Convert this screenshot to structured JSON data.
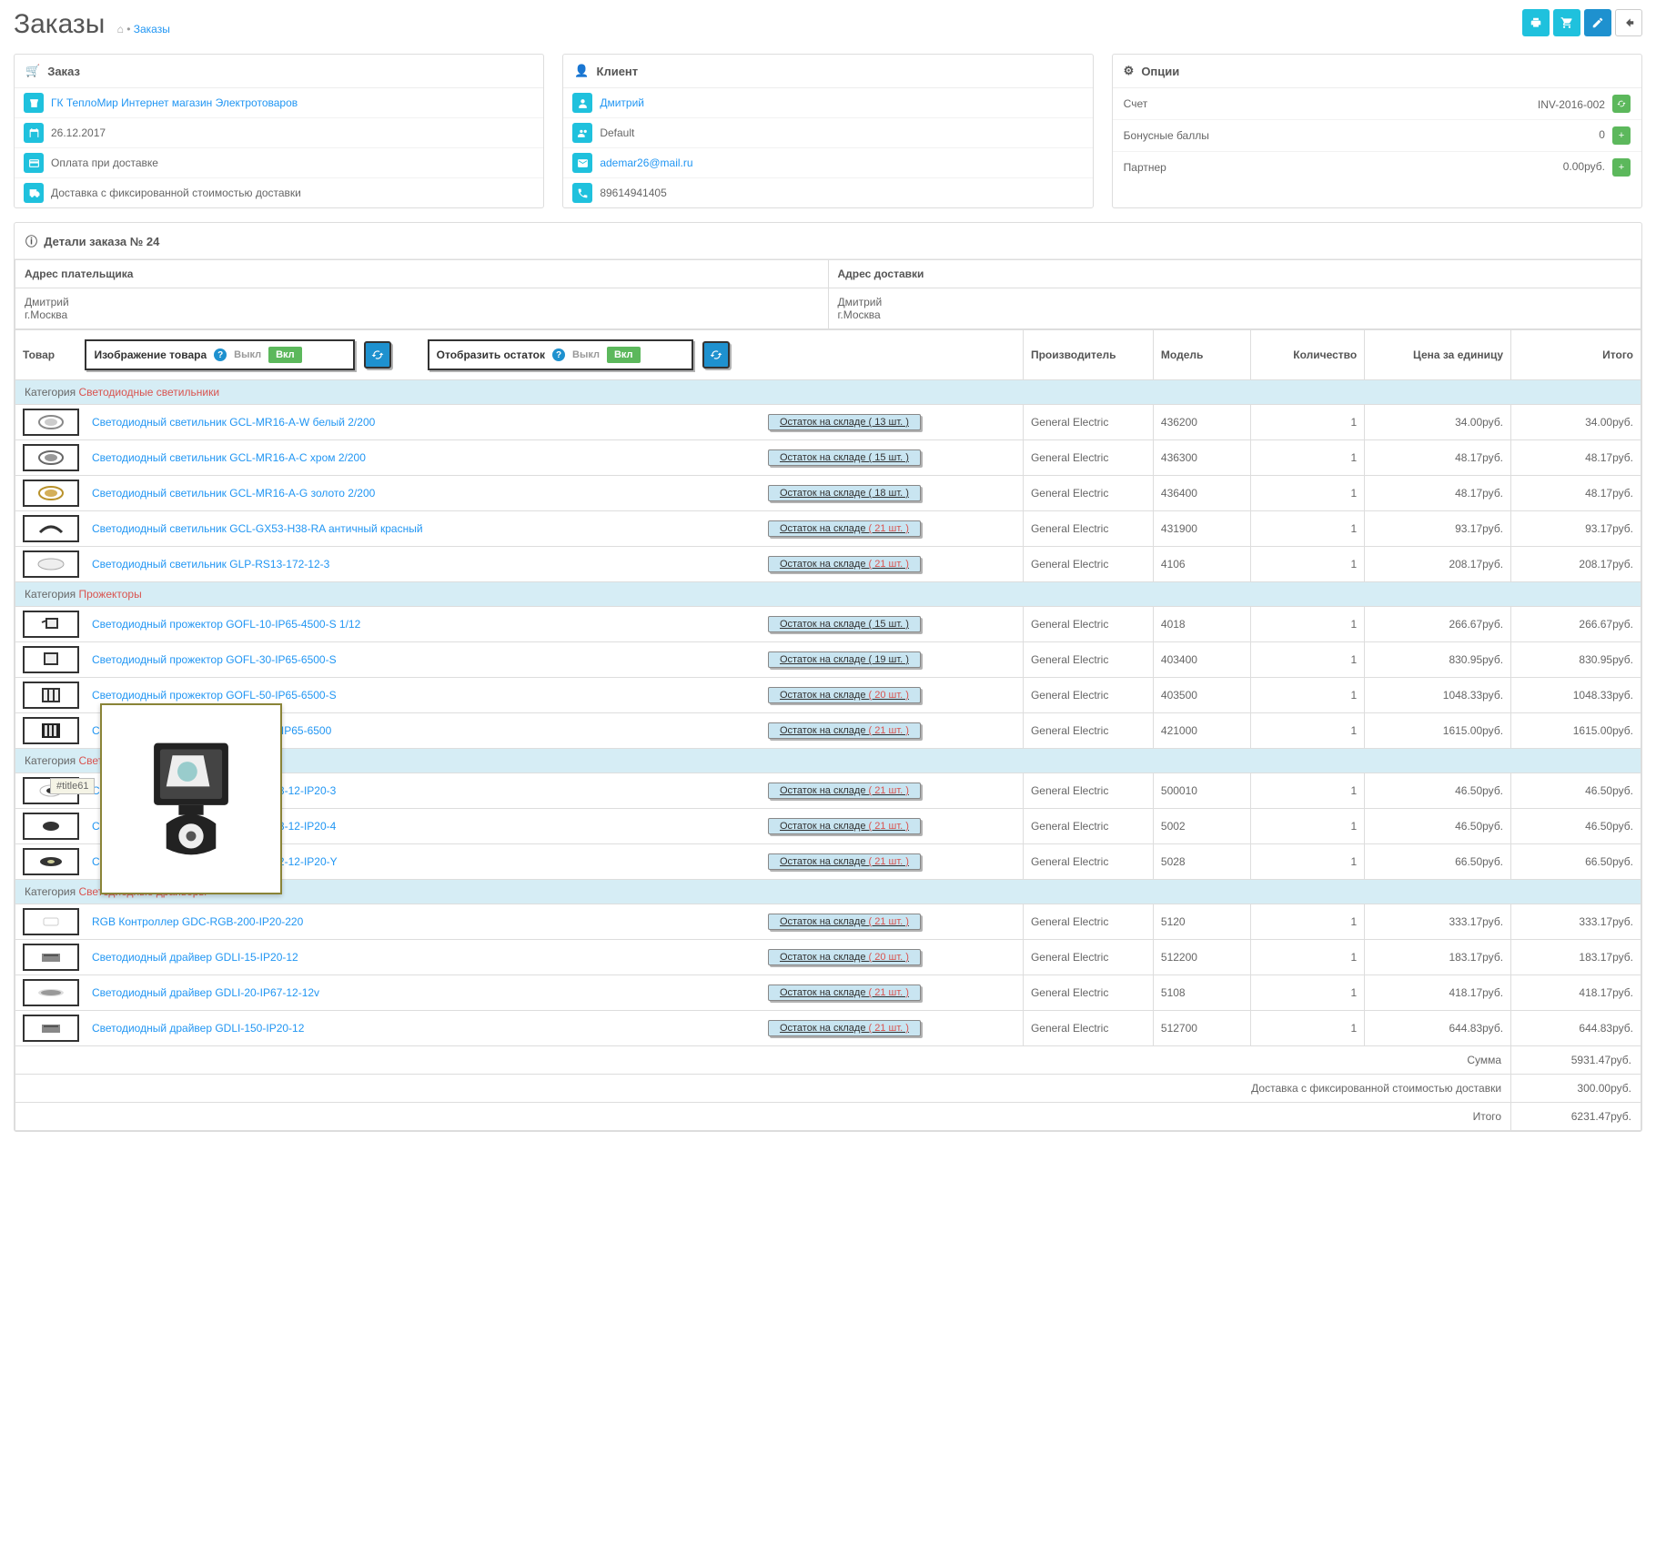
{
  "page": {
    "title": "Заказы",
    "bc_home": "⌂",
    "bc_page": "Заказы"
  },
  "toolbar": {
    "print": "print",
    "cart": "cart",
    "edit": "edit",
    "back": "back"
  },
  "order_panel": {
    "title": "Заказ",
    "store": "ГК ТеплоМир Интернет магазин Электротоваров",
    "date": "26.12.2017",
    "payment": "Оплата при доставке",
    "shipping": "Доставка с фиксированной стоимостью доставки"
  },
  "client_panel": {
    "title": "Клиент",
    "name": "Дмитрий",
    "group": "Default",
    "email": "ademar26@mail.ru",
    "phone": "89614941405"
  },
  "options_panel": {
    "title": "Опции",
    "invoice_lbl": "Счет",
    "invoice_val": "INV-2016-002",
    "bonus_lbl": "Бонусные баллы",
    "bonus_val": "0",
    "partner_lbl": "Партнер",
    "partner_val": "0.00руб."
  },
  "details": {
    "title": "Детали заказа № 24",
    "payer_h": "Адрес плательщика",
    "ship_h": "Адрес доставки",
    "payer_name": "Дмитрий",
    "payer_city": "г.Москва",
    "ship_name": "Дмитрий",
    "ship_city": "г.Москва"
  },
  "cols": {
    "product": "Товар",
    "mfr": "Производитель",
    "model": "Модель",
    "qty": "Количество",
    "price": "Цена за единицу",
    "total": "Итого"
  },
  "toggles": {
    "image_lbl": "Изображение товара",
    "stock_lbl": "Отобразить остаток",
    "off": "Выкл",
    "on": "Вкл"
  },
  "stock_label": "Остаток на складе",
  "cat_prefix": "Категория",
  "categories": [
    {
      "name": "Светодиодные светильники",
      "rows": [
        {
          "name": "Светодиодный светильник GCL-MR16-A-W белый 2/200",
          "stock": "( 13 шт. )",
          "mfr": "General Electric",
          "model": "436200",
          "qty": "1",
          "price": "34.00руб.",
          "total": "34.00руб."
        },
        {
          "name": "Светодиодный светильник GCL-MR16-A-C хром 2/200",
          "stock": "( 15 шт. )",
          "mfr": "General Electric",
          "model": "436300",
          "qty": "1",
          "price": "48.17руб.",
          "total": "48.17руб."
        },
        {
          "name": "Светодиодный светильник GCL-MR16-A-G золото 2/200",
          "stock": "( 18 шт. )",
          "mfr": "General Electric",
          "model": "436400",
          "qty": "1",
          "price": "48.17руб.",
          "total": "48.17руб."
        },
        {
          "name": "Светодиодный светильник GCL-GX53-H38-RA античный красный",
          "stock": "( 21 шт. )",
          "mfr": "General Electric",
          "model": "431900",
          "qty": "1",
          "price": "93.17руб.",
          "total": "93.17руб."
        },
        {
          "name": "Светодиодный светильник GLP-RS13-172-12-3",
          "stock": "( 21 шт. )",
          "mfr": "General Electric",
          "model": "4106",
          "qty": "1",
          "price": "208.17руб.",
          "total": "208.17руб."
        }
      ]
    },
    {
      "name": "Прожекторы",
      "rows": [
        {
          "name": "Светодиодный прожектор GOFL-10-IP65-4500-S 1/12",
          "stock": "( 15 шт. )",
          "mfr": "General Electric",
          "model": "4018",
          "qty": "1",
          "price": "266.67руб.",
          "total": "266.67руб."
        },
        {
          "name": "Светодиодный прожектор GOFL-30-IP65-6500-S",
          "stock": "( 19 шт. )",
          "mfr": "General Electric",
          "model": "403400",
          "qty": "1",
          "price": "830.95руб.",
          "total": "830.95руб."
        },
        {
          "name": "Светодиодный прожектор GOFL-50-IP65-6500-S",
          "stock": "( 20 шт. )",
          "mfr": "General Electric",
          "model": "403500",
          "qty": "1",
          "price": "1048.33руб.",
          "total": "1048.33руб."
        },
        {
          "name": "Светодиодный прожектор GOFL-100-IP65-6500",
          "stock": "( 21 шт. )",
          "mfr": "General Electric",
          "model": "421000",
          "qty": "1",
          "price": "1615.00руб.",
          "total": "1615.00руб."
        }
      ]
    },
    {
      "name": "Светодиодные ленты",
      "rows": [
        {
          "name": "Светодиодная лента GLS-2835-60-4.8-12-IP20-3",
          "stock": "( 21 шт. )",
          "mfr": "General Electric",
          "model": "500010",
          "qty": "1",
          "price": "46.50руб.",
          "total": "46.50руб."
        },
        {
          "name": "Светодиодная лента GLS-3528-60-4.8-12-IP20-4",
          "stock": "( 21 шт. )",
          "mfr": "General Electric",
          "model": "5002",
          "qty": "1",
          "price": "46.50руб.",
          "total": "46.50руб."
        },
        {
          "name": "Светодиодная лента GLS-5050-30-7.2-12-IP20-Y",
          "stock": "( 21 шт. )",
          "mfr": "General Electric",
          "model": "5028",
          "qty": "1",
          "price": "66.50руб.",
          "total": "66.50руб."
        }
      ]
    },
    {
      "name": "Светодиодные драйверы",
      "rows": [
        {
          "name": "RGB Контроллер GDC-RGB-200-IP20-220",
          "stock": "( 21 шт. )",
          "mfr": "General Electric",
          "model": "5120",
          "qty": "1",
          "price": "333.17руб.",
          "total": "333.17руб."
        },
        {
          "name": "Светодиодный драйвер GDLI-15-IP20-12",
          "stock": "( 20 шт. )",
          "mfr": "General Electric",
          "model": "512200",
          "qty": "1",
          "price": "183.17руб.",
          "total": "183.17руб."
        },
        {
          "name": "Светодиодный драйвер GDLI-20-IP67-12-12v",
          "stock": "( 21 шт. )",
          "mfr": "General Electric",
          "model": "5108",
          "qty": "1",
          "price": "418.17руб.",
          "total": "418.17руб."
        },
        {
          "name": "Светодиодный драйвер GDLI-150-IP20-12",
          "stock": "( 21 шт. )",
          "mfr": "General Electric",
          "model": "512700",
          "qty": "1",
          "price": "644.83руб.",
          "total": "644.83руб."
        }
      ]
    }
  ],
  "totals": [
    {
      "lbl": "Сумма",
      "val": "5931.47руб."
    },
    {
      "lbl": "Доставка с фиксированной стоимостью доставки",
      "val": "300.00руб."
    },
    {
      "lbl": "Итого",
      "val": "6231.47руб."
    }
  ],
  "tooltip": "#title61"
}
